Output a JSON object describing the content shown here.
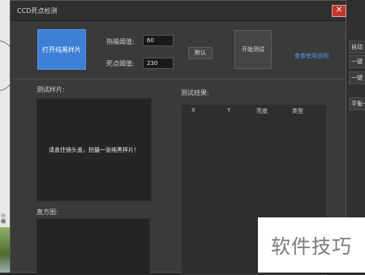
{
  "window": {
    "title": "CCD死点检测",
    "close_glyph": "✕"
  },
  "buttons": {
    "open_black": "打开纯黑样片",
    "default": "默认",
    "start_test": "开始测试",
    "help": "查看使用说明"
  },
  "thresholds": {
    "hot_label": "热噪阈值:",
    "hot_value": "60",
    "dead_label": "死点阈值:",
    "dead_value": "230"
  },
  "sample": {
    "label": "测试样片:",
    "message": "请盖住镜头盖，拍摄一张纯黑样片！"
  },
  "results": {
    "label": "测试结果:",
    "columns": [
      "X",
      "Y",
      "亮度",
      "类型"
    ]
  },
  "histogram": {
    "label": "直方图:"
  },
  "background_app": {
    "side_buttons": [
      "自动",
      "一键",
      "一键",
      "平衡一"
    ],
    "left_text": "小编"
  },
  "watermark": {
    "text": "软件技巧"
  }
}
